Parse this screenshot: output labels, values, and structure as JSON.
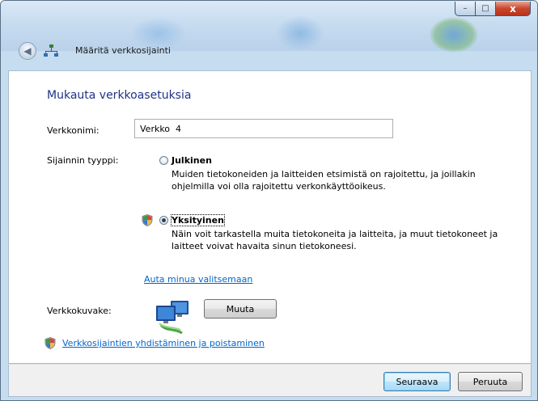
{
  "window": {
    "nav_title": "Määritä verkkosijainti",
    "caption": {
      "minimize": "–",
      "maximize": "□",
      "close": "x"
    }
  },
  "page": {
    "heading": "Mukauta verkkoasetuksia",
    "network_name_label": "Verkkonimi:",
    "network_name_value": "Verkko  4",
    "location_type_label": "Sijainnin tyyppi:",
    "options": [
      {
        "title": "Julkinen",
        "description": "Muiden tietokoneiden ja laitteiden etsimistä on rajoitettu, ja joillakin ohjelmilla voi olla rajoitettu verkonkäyttöoikeus.",
        "selected": false
      },
      {
        "title": "Yksityinen",
        "description": "Näin voit tarkastella muita tietokoneita ja laitteita, ja muut tietokoneet ja laitteet voivat havaita sinun tietokoneesi.",
        "selected": true
      }
    ],
    "help_link": "Auta minua valitsemaan",
    "network_icon_label": "Verkkokuvake:",
    "change_button": "Muuta",
    "merge_link": "Verkkosijaintien yhdistäminen ja poistaminen"
  },
  "footer": {
    "next_button": "Seuraava",
    "cancel_button": "Peruuta"
  },
  "colors": {
    "heading": "#1e3287",
    "link": "#0066cc",
    "chrome": "#c6dcef"
  },
  "icons": [
    "back-arrow-icon",
    "network-icon",
    "shield-icon",
    "network-computers-icon"
  ]
}
